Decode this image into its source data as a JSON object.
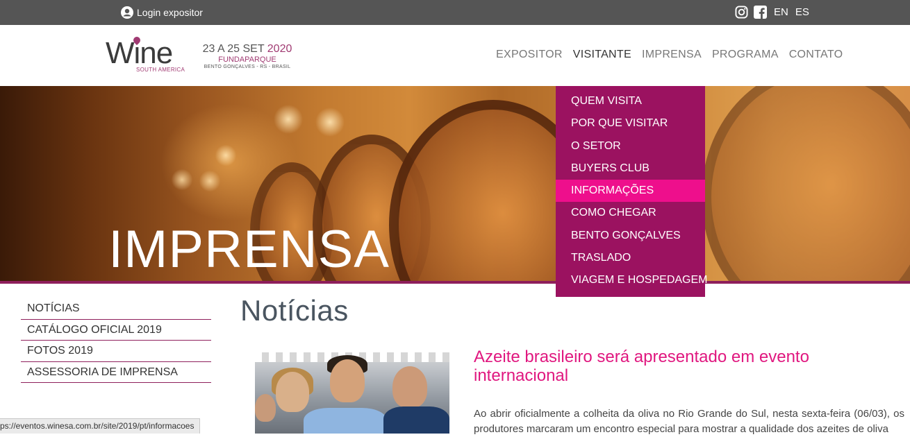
{
  "topbar": {
    "login_label": "Login expositor",
    "languages": [
      "EN",
      "ES"
    ],
    "social_icons": [
      "instagram-icon",
      "facebook-icon"
    ]
  },
  "header": {
    "logo_word": "Wine",
    "logo_sub": "SOUTH AMERICA",
    "event_dates": "23 A 25 SET",
    "event_year": "2020",
    "event_venue": "FUNDAPARQUE",
    "event_location": "BENTO GONÇALVES - RS - BRASIL"
  },
  "nav": {
    "items": [
      {
        "label": "EXPOSITOR"
      },
      {
        "label": "VISITANTE"
      },
      {
        "label": "IMPRENSA"
      },
      {
        "label": "PROGRAMA"
      },
      {
        "label": "CONTATO"
      }
    ],
    "active": "VISITANTE"
  },
  "dropdown": {
    "items": [
      {
        "label": "QUEM VISITA"
      },
      {
        "label": "POR QUE VISITAR"
      },
      {
        "label": "O SETOR"
      },
      {
        "label": "BUYERS CLUB"
      },
      {
        "label": "INFORMAÇÕES"
      },
      {
        "label": "COMO CHEGAR"
      },
      {
        "label": "BENTO GONÇALVES"
      },
      {
        "label": "TRASLADO"
      },
      {
        "label": "VIAGEM E HOSPEDAGEM"
      }
    ],
    "highlighted": "INFORMAÇÕES"
  },
  "hero": {
    "title": "IMPRENSA"
  },
  "sidebar": {
    "items": [
      {
        "label": "NOTÍCIAS"
      },
      {
        "label": "CATÁLOGO OFICIAL 2019"
      },
      {
        "label": "FOTOS 2019"
      },
      {
        "label": "ASSESSORIA DE IMPRENSA"
      }
    ]
  },
  "content": {
    "section_title": "Notícias",
    "article": {
      "title": "Azeite brasileiro será apresentado em evento internacional",
      "text": "Ao abrir oficialmente a colheita da oliva no Rio Grande do Sul, nesta sexta-feira (06/03), os produtores marcaram um encontro especial para mostrar a qualidade dos azeites de oliva"
    }
  },
  "status_bar": {
    "url": "ps://eventos.winesa.com.br/site/2019/pt/informacoes"
  },
  "colors": {
    "topbar_bg": "#555555",
    "brand_purple": "#9b1260",
    "highlight_pink": "#ee0f8c",
    "accent_line": "#8e1f5b",
    "headline_pink": "#e0177f"
  }
}
